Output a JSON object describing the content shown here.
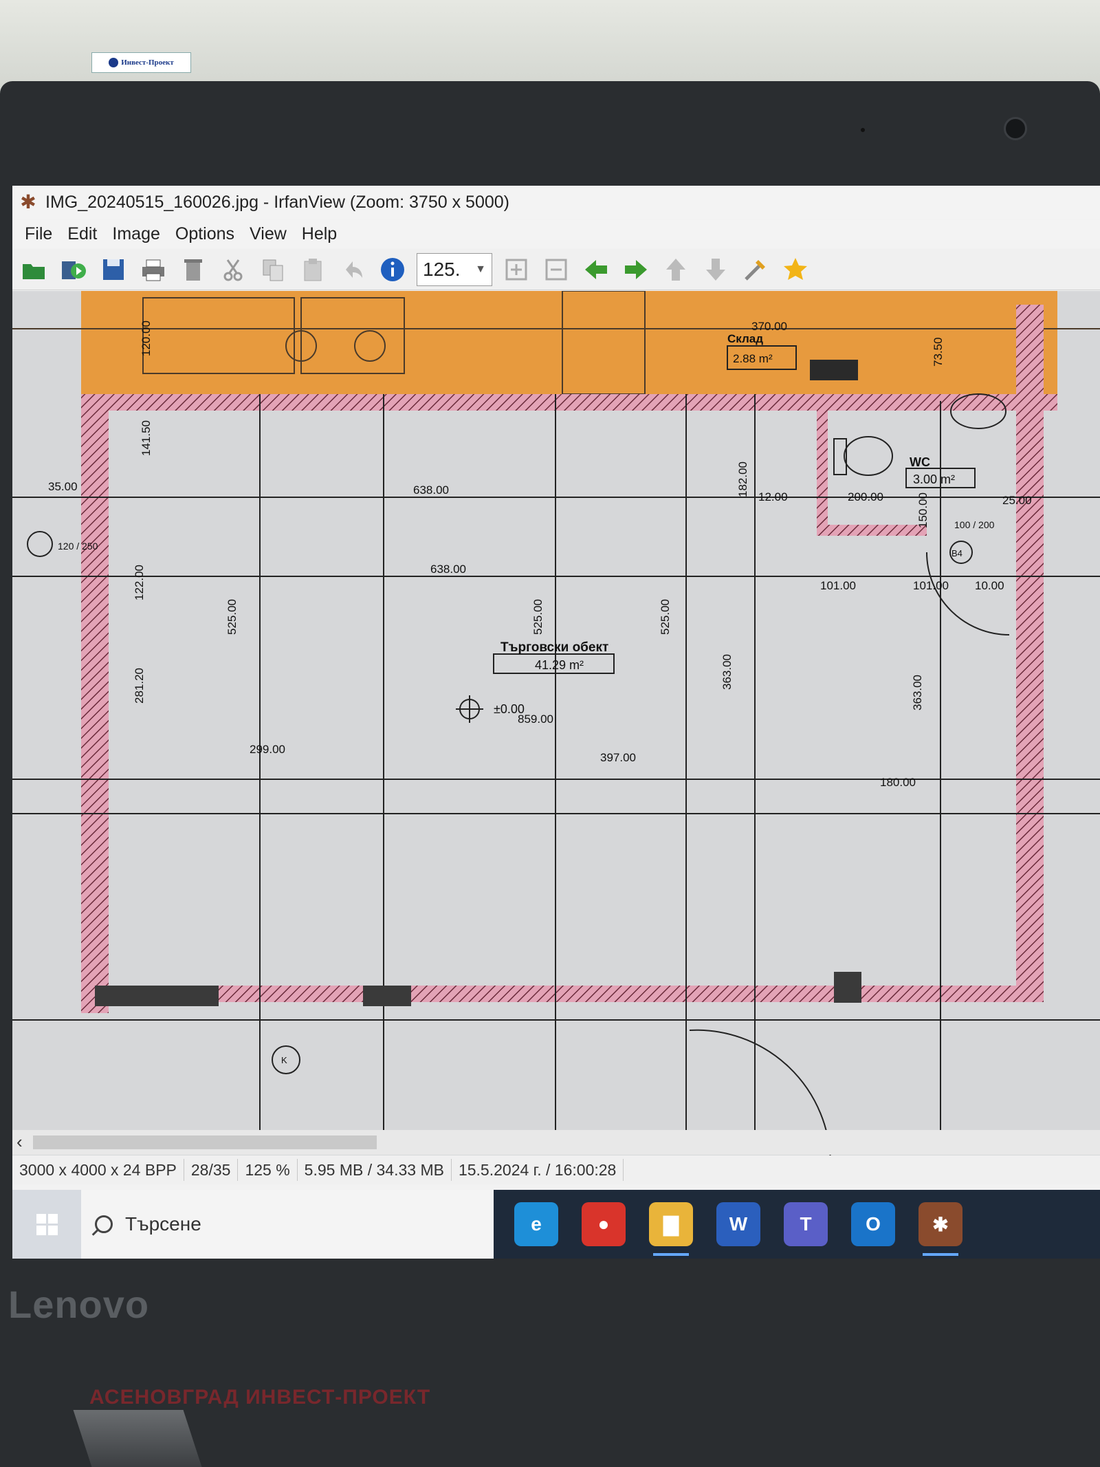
{
  "logo_text": "Инвест-Проект",
  "device_brand": "Lenovo",
  "watermark": "АСЕНОВГРАД ИНВЕСТ-ПРОЕКТ",
  "window": {
    "title": "IMG_20240515_160026.jpg - IrfanView (Zoom: 3750 x 5000)"
  },
  "menu": [
    "File",
    "Edit",
    "Image",
    "Options",
    "View",
    "Help"
  ],
  "toolbar": {
    "zoom_value": "125.",
    "icons": [
      "open-icon",
      "slideshow-icon",
      "save-icon",
      "print-icon",
      "delete-icon",
      "cut-icon",
      "copy-icon",
      "paste-icon",
      "undo-icon",
      "info-icon",
      "zoom-in-icon",
      "zoom-out-icon",
      "prev-icon",
      "next-icon",
      "up-icon",
      "down-icon",
      "settings-icon",
      "favorite-icon"
    ]
  },
  "plan": {
    "room_main_name": "Търговски обект",
    "room_main_area": "41.29 m²",
    "room_wc_name": "WC",
    "room_wc_area": "3.00 m²",
    "room_store_name": "Склад",
    "room_store_area": "2.88 m²",
    "level": "±0.00",
    "dims": [
      "638.00",
      "638.00",
      "859.00",
      "397.00",
      "299.00",
      "525.00",
      "525.00",
      "525.00",
      "363.00",
      "363.00",
      "182.00",
      "200.00",
      "12.00",
      "101.00",
      "101.00",
      "10.00",
      "25.00",
      "35.00",
      "180.00",
      "370.00",
      "281.20",
      "141.50",
      "122.00",
      "150.00",
      "120.00",
      "73.50"
    ],
    "tag_b4": "B4",
    "tag_k": "K",
    "tag_ratio": "100 / 200",
    "tag_left": "120 / 250"
  },
  "status": [
    "3000 x 4000 x 24 BPP",
    "28/35",
    "125 %",
    "5.95 MB / 34.33 MB",
    "15.5.2024 г. / 16:00:28"
  ],
  "taskbar": {
    "search_placeholder": "Търсене",
    "apps": [
      {
        "name": "edge",
        "label": "e",
        "color": "#1e8fd8"
      },
      {
        "name": "chrome",
        "label": "●",
        "color": "#d9342b"
      },
      {
        "name": "explorer",
        "label": "▇",
        "color": "#e9b43a"
      },
      {
        "name": "word",
        "label": "W",
        "color": "#2b5fbd"
      },
      {
        "name": "teams",
        "label": "T",
        "color": "#5a5fc7"
      },
      {
        "name": "outlook",
        "label": "O",
        "color": "#1a74c9"
      },
      {
        "name": "irfanview",
        "label": "✱",
        "color": "#8a4b2d"
      }
    ]
  }
}
